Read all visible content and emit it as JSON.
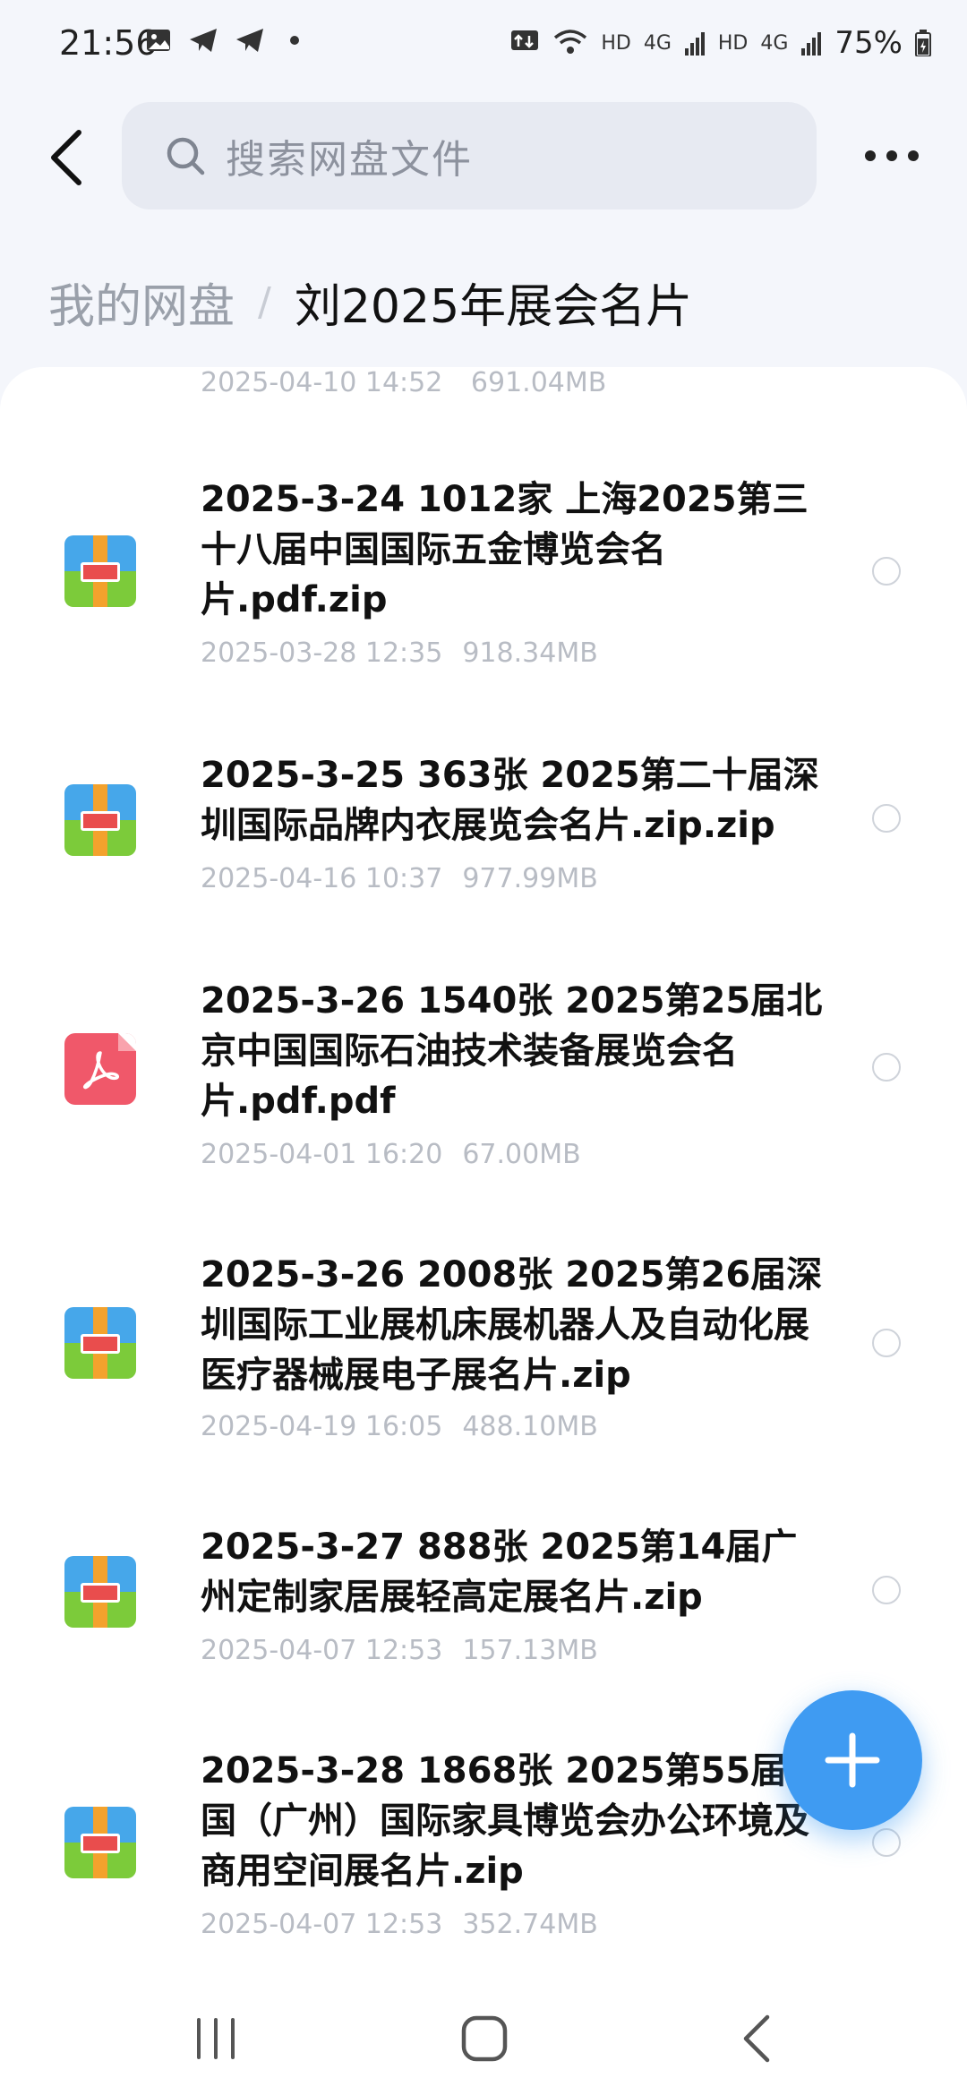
{
  "status_bar": {
    "time": "21:56",
    "left_icons": [
      "image-icon",
      "telegram-icon",
      "telegram-icon"
    ],
    "signal_labels": [
      "HD",
      "4G",
      "HD",
      "4G"
    ],
    "battery": "75%"
  },
  "header": {
    "search_placeholder": "搜索网盘文件",
    "back_icon": "chevron-left-icon",
    "more_icon": "more-horizontal-icon"
  },
  "breadcrumb": {
    "root": "我的网盘",
    "separator": "/",
    "current": "刘2025年展会名片"
  },
  "partial_item": {
    "date": "2025-04-10 14:52",
    "size": "691.04MB"
  },
  "files": [
    {
      "name": "2025-3-24 1012家 上海2025第三十八届中国国际五金博览会名片.pdf.zip",
      "date": "2025-03-28 12:35",
      "size": "918.34MB",
      "type": "zip"
    },
    {
      "name": "2025-3-25 363张 2025第二十届深圳国际品牌内衣展览会名片.zip.zip",
      "date": "2025-04-16 10:37",
      "size": "977.99MB",
      "type": "zip"
    },
    {
      "name": "2025-3-26 1540张 2025第25届北京中国国际石油技术装备展览会名片.pdf.pdf",
      "date": "2025-04-01 16:20",
      "size": "67.00MB",
      "type": "pdf"
    },
    {
      "name": "2025-3-26 2008张 2025第26届深圳国际工业展机床展机器人及自动化展医疗器械展电子展名片.zip",
      "date": "2025-04-19 16:05",
      "size": "488.10MB",
      "type": "zip"
    },
    {
      "name": "2025-3-27 888张 2025第14届广州定制家居展轻高定展名片.zip",
      "date": "2025-04-07 12:53",
      "size": "157.13MB",
      "type": "zip"
    },
    {
      "name": "2025-3-28 1868张 2025第55届中国（广州）国际家具博览会办公环境及商用空间展名片.zip",
      "date": "2025-04-07 12:53",
      "size": "352.74MB",
      "type": "zip"
    }
  ],
  "fab_icon": "plus-icon",
  "nav": [
    "recent-apps-icon",
    "home-icon",
    "back-icon"
  ],
  "colors": {
    "accent": "#3f9bf2",
    "zip_blue": "#46a7ea",
    "zip_green": "#7ccb3a",
    "zip_orange": "#f3a22d",
    "pdf_red": "#f0586a"
  }
}
